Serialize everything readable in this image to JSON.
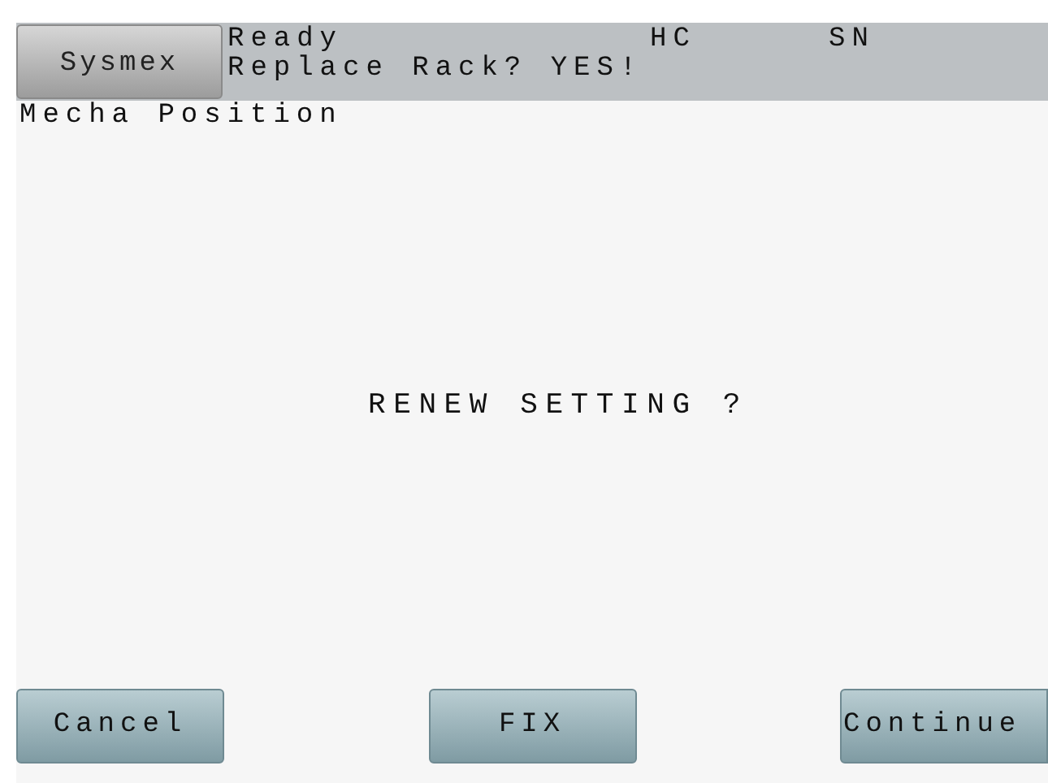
{
  "header": {
    "logo_button": "Sysmex",
    "status": [
      {
        "text": "Ready"
      },
      {
        "text": "Replace Rack? YES!"
      }
    ],
    "indicators": [
      "HC",
      "SN"
    ]
  },
  "title": "Mecha Position",
  "message": "RENEW SETTING ?",
  "buttons": [
    "Cancel",
    "FIX",
    "Continue"
  ]
}
